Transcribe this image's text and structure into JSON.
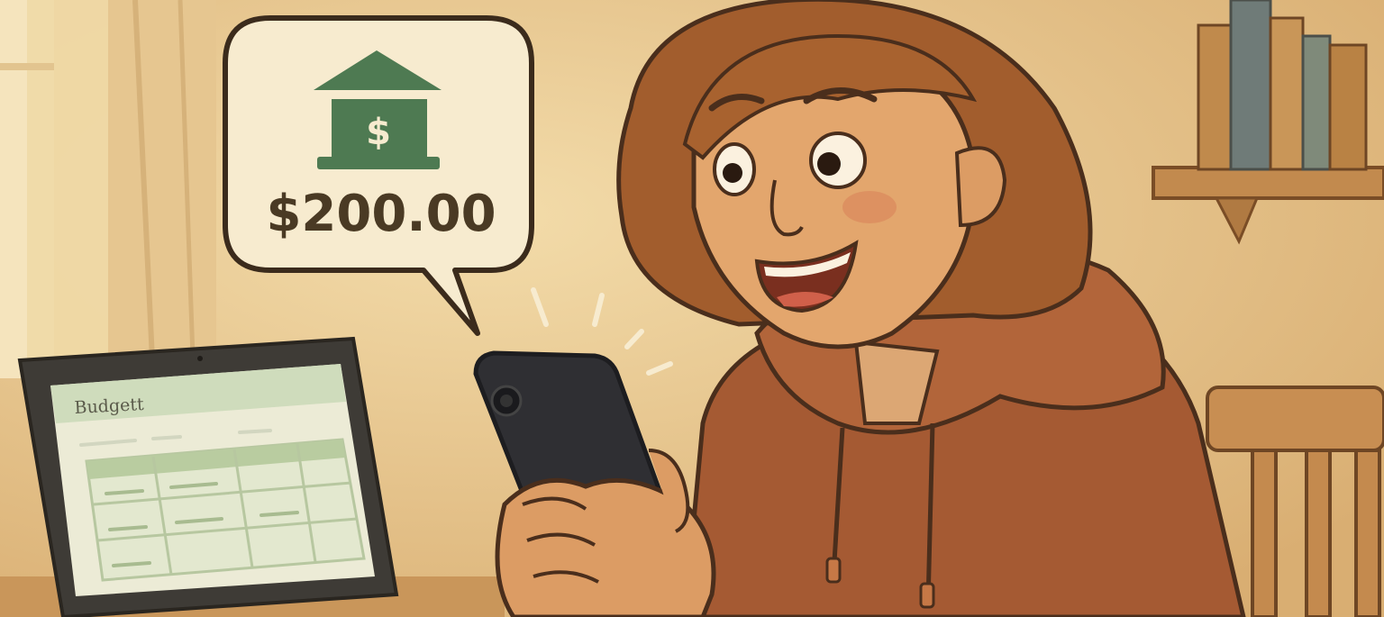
{
  "speech_bubble": {
    "icon": "bank-dollar-icon",
    "amount": "$200.00"
  },
  "laptop": {
    "app_title": "Budgett"
  },
  "colors": {
    "background_warm": "#e8c893",
    "bank_green": "#4e7a52",
    "hoodie": "#a55a33",
    "hair": "#a25d2d",
    "outline": "#4a2e1c"
  }
}
